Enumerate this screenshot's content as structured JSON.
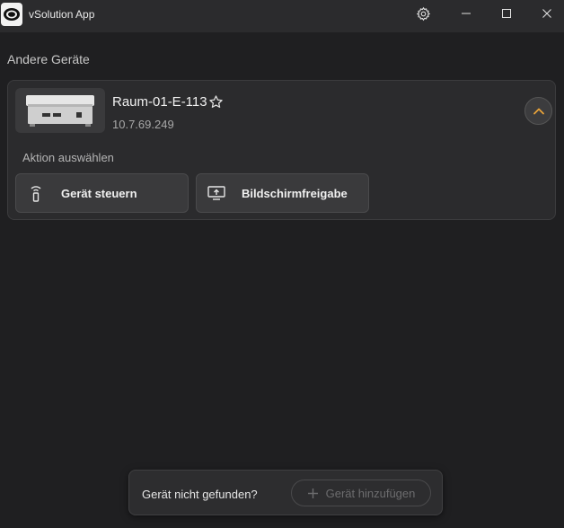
{
  "window": {
    "title": "vSolution App",
    "controls": {
      "settings_icon": "gear-icon",
      "minimize_icon": "minimize-icon",
      "maximize_icon": "maximize-icon",
      "close_icon": "close-icon"
    }
  },
  "section": {
    "title": "Andere Geräte"
  },
  "device": {
    "name": "Raum-01-E-113",
    "ip": "10.7.69.249",
    "favorite_icon": "star-outline-icon",
    "expanded": true,
    "action_label": "Aktion auswählen",
    "actions": [
      {
        "label": "Gerät steuern",
        "icon": "remote-icon"
      },
      {
        "label": "Bildschirmfreigabe",
        "icon": "screen-share-icon"
      }
    ]
  },
  "toast": {
    "message": "Gerät nicht gefunden?",
    "add_button_label": "Gerät hinzufügen",
    "add_button_enabled": false
  },
  "colors": {
    "background": "#1f1f21",
    "titlebar": "#2b2b2d",
    "card": "#2b2b2d",
    "accent": "#e8a33a"
  }
}
